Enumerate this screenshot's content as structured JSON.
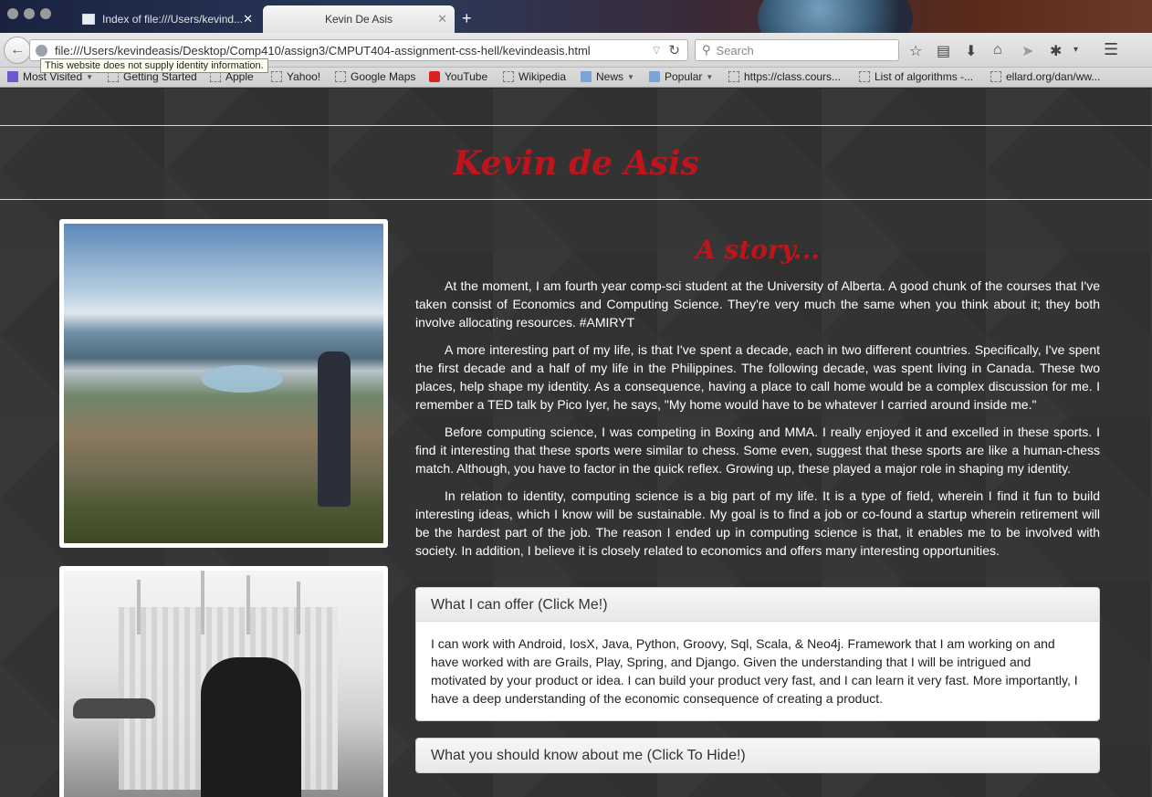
{
  "browser": {
    "tabs": [
      {
        "label": "Index of file:///Users/kevind...",
        "active": false
      },
      {
        "label": "Kevin De Asis",
        "active": true
      }
    ],
    "url": "file:///Users/kevindeasis/Desktop/Comp410/assign3/CMPUT404-assignment-css-hell/kevindeasis.html",
    "search_placeholder": "Search",
    "tooltip": "This website does not supply identity information.",
    "bookmarks": [
      {
        "label": "Most Visited",
        "icon": "most-visited-icon",
        "dropdown": true
      },
      {
        "label": "Getting Started",
        "icon": "page-icon"
      },
      {
        "label": "Apple",
        "icon": "page-icon"
      },
      {
        "label": "Yahoo!",
        "icon": "page-icon"
      },
      {
        "label": "Google Maps",
        "icon": "page-icon"
      },
      {
        "label": "YouTube",
        "icon": "youtube-icon"
      },
      {
        "label": "Wikipedia",
        "icon": "page-icon"
      },
      {
        "label": "News",
        "icon": "folder-icon",
        "dropdown": true
      },
      {
        "label": "Popular",
        "icon": "folder-icon",
        "dropdown": true
      },
      {
        "label": "https://class.cours...",
        "icon": "page-icon"
      },
      {
        "label": "List of algorithms -...",
        "icon": "page-icon"
      },
      {
        "label": "ellard.org/dan/ww...",
        "icon": "page-icon"
      }
    ]
  },
  "page": {
    "site_title": "Kevin de Asis",
    "story_title": "A story...",
    "paragraphs": [
      "At the moment, I am fourth year comp-sci student at the University of Alberta. A good chunk of the courses that I've taken consist of Economics and Computing Science. They're very much the same when you think about it; they both involve allocating resources. #AMIRYT",
      "A more interesting part of my life, is that I've spent a decade, each in two different countries. Specifically, I've spent the first decade and a half of my life in the Philippines. The following decade, was spent living in Canada. These two places, help shape my identity. As a consequence, having a place to call home would be a complex discussion for me. I remember a TED talk by Pico Iyer, he says, \"My home would have to be whatever I carried around inside me.\"",
      "Before computing science, I was competing in Boxing and MMA. I really enjoyed it and excelled in these sports. I find it interesting that these sports were similar to chess. Some even, suggest that these sports are like a human-chess match. Although, you have to factor in the quick reflex. Growing up, these played a major role in shaping my identity.",
      "In relation to identity, computing science is a big part of my life. It is a type of field, wherein I find it fun to build interesting ideas, which I know will be sustainable. My goal is to find a job or co-found a startup wherein retirement will be the hardest part of the job. The reason I ended up in computing science is that, it enables me to be involved with society. In addition, I believe it is closely related to economics and offers many interesting opportunities."
    ],
    "panels": [
      {
        "title": "What I can offer (Click Me!)",
        "body": "I can work with Android, IosX, Java, Python, Groovy, Sql, Scala, & Neo4j. Framework that I am working on and have worked with are Grails, Play, Spring, and Django. Given the understanding that I will be intrigued and motivated by your product or idea. I can build your product very fast, and I can learn it very fast. More importantly, I have a deep understanding of the economic consequence of creating a product.",
        "expanded": true
      },
      {
        "title": "What you should know about me (Click To Hide!)",
        "expanded": false
      }
    ],
    "colors": {
      "accent": "#c0141c",
      "background": "#333333"
    }
  }
}
